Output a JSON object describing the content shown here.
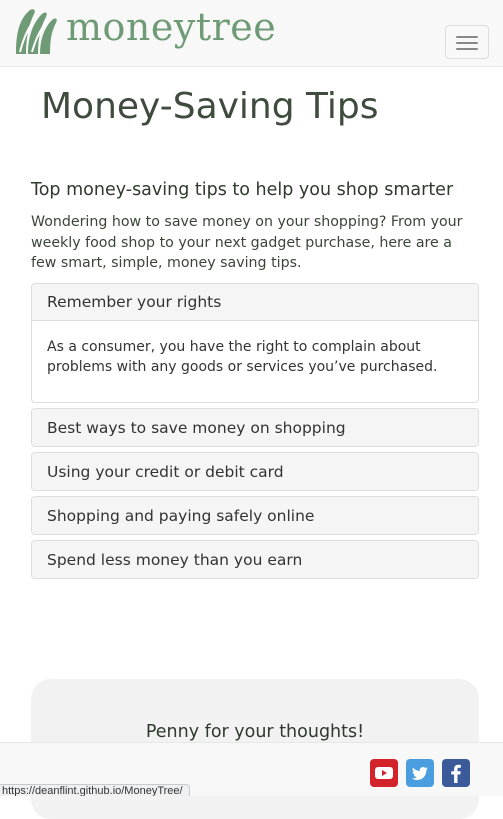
{
  "navbar": {
    "brand_name": "moneytree",
    "brand_color": "#6e9b75",
    "logo_icon": "leaf-logo-icon",
    "menu_icon": "hamburger-menu-icon"
  },
  "main": {
    "page_title": "Money-Saving Tips",
    "section_heading": "Top money-saving tips to help you shop smarter",
    "intro": "Wondering how to save money on your shopping? From your weekly food shop to your next gadget purchase, here are a few smart, simple, money saving tips."
  },
  "accordion": {
    "panels": [
      {
        "title": "Remember your rights",
        "expanded": true,
        "body": "As a consumer, you have the right to complain about problems with any goods or services you’ve purchased."
      },
      {
        "title": "Best ways to save money on shopping",
        "expanded": false
      },
      {
        "title": "Using your credit or debit card",
        "expanded": false
      },
      {
        "title": "Shopping and paying safely online",
        "expanded": false
      },
      {
        "title": "Spend less money than you earn",
        "expanded": false
      }
    ]
  },
  "penny": {
    "title": "Penny for your thoughts!"
  },
  "footer": {
    "social": [
      {
        "icon": "youtube-icon",
        "color": "#d3242b"
      },
      {
        "icon": "twitter-icon",
        "color": "#4a9ee0"
      },
      {
        "icon": "facebook-icon",
        "color": "#3b5a9a"
      }
    ]
  },
  "statusbar": {
    "url": "https://deanflint.github.io/MoneyTree/"
  }
}
